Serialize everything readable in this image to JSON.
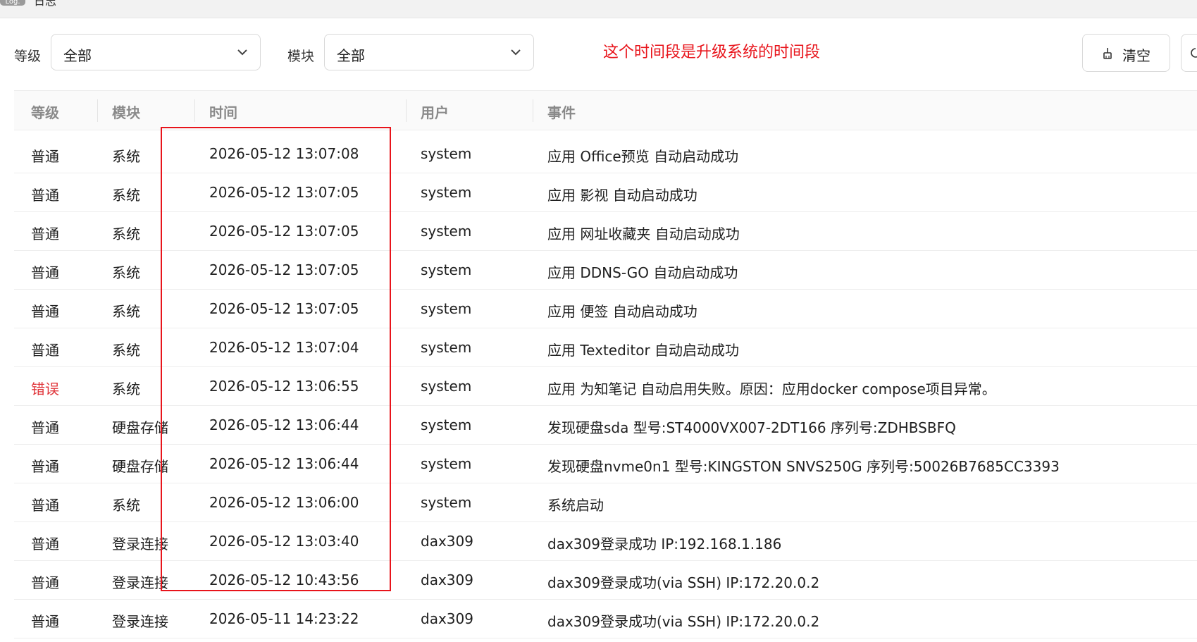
{
  "titlebar": {
    "logo_text": "Log.",
    "title": "日志"
  },
  "filters": {
    "level_label": "等级",
    "level_value": "全部",
    "module_label": "模块",
    "module_value": "全部"
  },
  "annotation": "这个时间段是升级系统的时间段",
  "toolbar": {
    "clear_label": "清空"
  },
  "table": {
    "columns": [
      "等级",
      "模块",
      "时间",
      "用户",
      "事件"
    ],
    "rows": [
      {
        "level": "普通",
        "module": "系统",
        "time": "2026-05-12 13:07:08",
        "user": "system",
        "event": "应用 Office预览 自动启动成功"
      },
      {
        "level": "普通",
        "module": "系统",
        "time": "2026-05-12 13:07:05",
        "user": "system",
        "event": "应用 影视 自动启动成功"
      },
      {
        "level": "普通",
        "module": "系统",
        "time": "2026-05-12 13:07:05",
        "user": "system",
        "event": "应用 网址收藏夹 自动启动成功"
      },
      {
        "level": "普通",
        "module": "系统",
        "time": "2026-05-12 13:07:05",
        "user": "system",
        "event": "应用 DDNS-GO 自动启动成功"
      },
      {
        "level": "普通",
        "module": "系统",
        "time": "2026-05-12 13:07:05",
        "user": "system",
        "event": "应用 便签 自动启动成功"
      },
      {
        "level": "普通",
        "module": "系统",
        "time": "2026-05-12 13:07:04",
        "user": "system",
        "event": "应用 Texteditor 自动启动成功"
      },
      {
        "level": "错误",
        "module": "系统",
        "time": "2026-05-12 13:06:55",
        "user": "system",
        "event": "应用 为知笔记 自动启用失败。原因：应用docker compose项目异常。"
      },
      {
        "level": "普通",
        "module": "硬盘存储",
        "time": "2026-05-12 13:06:44",
        "user": "system",
        "event": "发现硬盘sda 型号:ST4000VX007-2DT166 序列号:ZDHBSBFQ"
      },
      {
        "level": "普通",
        "module": "硬盘存储",
        "time": "2026-05-12 13:06:44",
        "user": "system",
        "event": "发现硬盘nvme0n1 型号:KINGSTON SNVS250G 序列号:50026B7685CC3393"
      },
      {
        "level": "普通",
        "module": "系统",
        "time": "2026-05-12 13:06:00",
        "user": "system",
        "event": "系统启动"
      },
      {
        "level": "普通",
        "module": "登录连接",
        "time": "2026-05-12 13:03:40",
        "user": "dax309",
        "event": "dax309登录成功 IP:192.168.1.186"
      },
      {
        "level": "普通",
        "module": "登录连接",
        "time": "2026-05-12 10:43:56",
        "user": "dax309",
        "event": "dax309登录成功(via SSH) IP:172.20.0.2"
      },
      {
        "level": "普通",
        "module": "登录连接",
        "time": "2026-05-11 14:23:22",
        "user": "dax309",
        "event": "dax309登录成功(via SSH) IP:172.20.0.2"
      }
    ]
  },
  "colors": {
    "error_level": "#e0353a",
    "annotation": "#e8141b",
    "highlight_box": "#e8141b"
  },
  "icons": {
    "clear": "clear-broom-icon",
    "dropdown": "chevron-down-icon",
    "extra": "refresh-icon"
  }
}
